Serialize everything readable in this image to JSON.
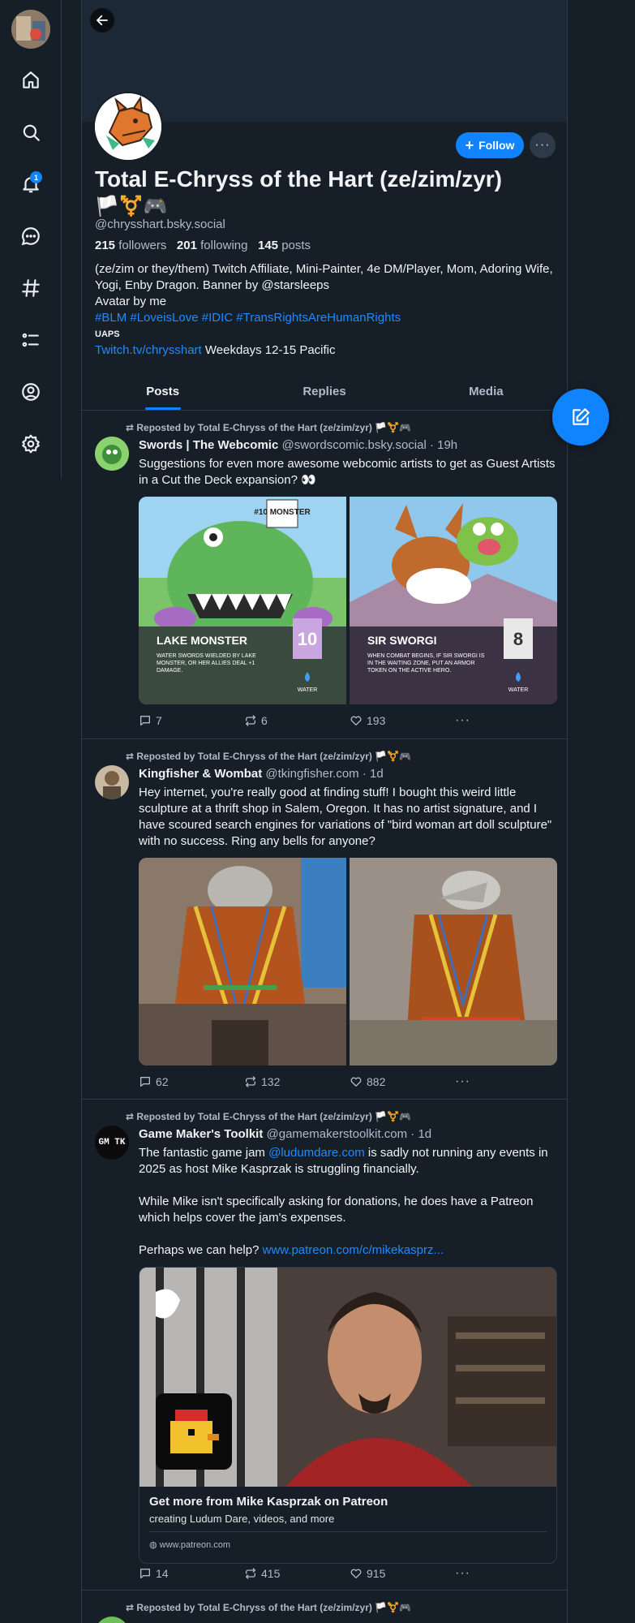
{
  "nav": {
    "notifications_badge": "1",
    "items": [
      "home-icon",
      "search-icon",
      "bell-icon",
      "chat-icon",
      "hash-icon",
      "list-icon",
      "profile-icon",
      "settings-icon"
    ]
  },
  "profile": {
    "display_name": "Total E-Chryss of the Hart (ze/zim/zyr)",
    "flags": "🏳️⚧️🎮",
    "handle": "@chrysshart.bsky.social",
    "followers_count": "215",
    "followers_label": "followers",
    "following_count": "201",
    "following_label": "following",
    "posts_count": "145",
    "posts_label": "posts",
    "bio_line1": "(ze/zim or they/them) Twitch Affiliate, Mini-Painter, 4e DM/Player, Mom, Adoring Wife, Yogi, Enby Dragon. Banner by @starsleeps",
    "bio_line2": "Avatar by me",
    "hashtags": "#BLM #LoveisLove #IDIC  #TransRightsAreHumanRights",
    "uaps": "UAPS",
    "twitch_link": "Twitch.tv/chrysshart",
    "schedule": " Weekdays 12-15 Pacific",
    "follow_label": "Follow",
    "more_label": "···"
  },
  "tabs": [
    {
      "label": "Posts",
      "active": true
    },
    {
      "label": "Replies",
      "active": false
    },
    {
      "label": "Media",
      "active": false
    }
  ],
  "posts": [
    {
      "repost_text": "Reposted by Total E-Chryss of the Hart (ze/zim/zyr) 🏳️⚧️🎮",
      "author_name": "Swords | The Webcomic",
      "author_meta": "@swordscomic.bsky.social · 19h",
      "text": "Suggestions for even more awesome webcomic artists to get as Guest Artists in a Cut the Deck expansion? 👀",
      "card_left": {
        "name": "LAKE MONSTER",
        "number": "10",
        "badge": "#10 MONSTER",
        "desc": "WATER SWORDS WIELDED BY LAKE MONSTER, OR HER ALLIES DEAL +1 DAMAGE.",
        "type": "WATER"
      },
      "card_right": {
        "name": "SIR SWORGI",
        "number": "8",
        "desc": "WHEN COMBAT BEGINS, IF SIR SWORGI IS IN THE WAITING ZONE, PUT AN ARMOR TOKEN ON THE ACTIVE HERO.",
        "type": "WATER"
      },
      "replies": "7",
      "reposts": "6",
      "likes": "193"
    },
    {
      "repost_text": "Reposted by Total E-Chryss of the Hart (ze/zim/zyr) 🏳️⚧️🎮",
      "author_name": "Kingfisher & Wombat",
      "author_meta": "@tkingfisher.com · 1d",
      "text": "Hey internet, you're really good at finding stuff! I bought this weird little sculpture at a thrift shop in Salem, Oregon. It has no artist signature, and I have scoured search engines for variations of \"bird woman art doll sculpture\" with no success. Ring any bells for anyone?",
      "replies": "62",
      "reposts": "132",
      "likes": "882"
    },
    {
      "repost_text": "Reposted by Total E-Chryss of the Hart (ze/zim/zyr) 🏳️⚧️🎮",
      "author_name": "Game Maker's Toolkit",
      "author_meta": "@gamemakerstoolkit.com · 1d",
      "avatar_text": "GM TK",
      "text_a": "The fantastic game jam ",
      "text_link": "@ludumdare.com",
      "text_b": " is sadly not running any events in 2025 as host Mike Kasprzak is struggling financially.",
      "text_p2": "While Mike isn't specifically asking for donations, he does have a Patreon which helps cover the jam's expenses.",
      "text_p3": "Perhaps we can help? ",
      "text_p3_link": "www.patreon.com/c/mikekasprz...",
      "card_title": "Get more from Mike Kasprzak on Patreon",
      "card_desc": "creating Ludum Dare, videos, and more",
      "card_url": "www.patreon.com",
      "replies": "14",
      "reposts": "415",
      "likes": "915"
    },
    {
      "repost_text": "Reposted by Total E-Chryss of the Hart (ze/zim/zyr) 🏳️⚧️🎮"
    }
  ],
  "colors": {
    "accent": "#1083fe",
    "link": "#208bfe",
    "background": "#161e27",
    "muted": "#aebbc9"
  }
}
